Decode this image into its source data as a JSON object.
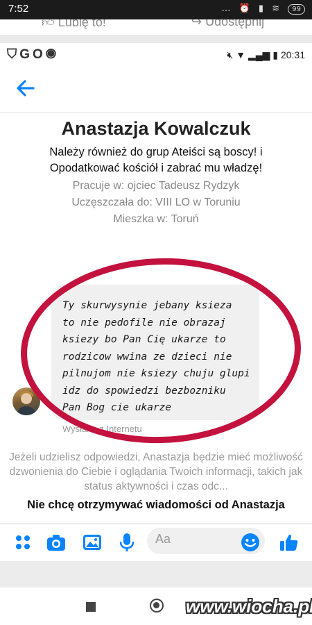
{
  "outer_status": {
    "time": "7:52",
    "icons": "… ⏰ ▮ ≋",
    "battery": "99"
  },
  "fb_bar": {
    "like_label": "Lubię to!",
    "share_label": "Udostępnij"
  },
  "inner_status": {
    "app_icons": "GO",
    "time": "20:31"
  },
  "profile": {
    "name": "Anastazja Kowalczuk",
    "groups_line1": "Należy również do grup Ateiści są boscy! i",
    "groups_line2": "Opodatkować kościół i zabrać mu władzę!",
    "work": "Pracuje w: ojciec Tadeusz Rydzyk",
    "school": "Uczęszczała do: VIII LO w Toruniu",
    "lives": "Mieszka w: Toruń"
  },
  "message": {
    "text": "Ty skurwysynie jebany ksieza\nto nie pedofile nie obrazaj\nksiezy bo Pan Cię ukarze to\nrodzicow wwina ze dzieci nie\npilnujom nie ksiezy chuju glupi\nidz do spowiedzi bezbozniku\nPan Bog cie ukarze",
    "sent_via": "Wysłane z Internetu"
  },
  "info": {
    "text": "Jeżeli udzielisz odpowiedzi, Anastazja będzie mieć możliwość dzwonienia do Ciebie i oglądania Twoich informacji, takich jak status aktywności i czas odc...",
    "block_label": "Nie chcę otrzymywać wiadomości od Anastazja"
  },
  "composer": {
    "placeholder": "Aa"
  },
  "colors": {
    "messenger_blue": "#0a84ff",
    "circle_red": "#c3123e"
  },
  "watermark": "www.wiocha.pl"
}
